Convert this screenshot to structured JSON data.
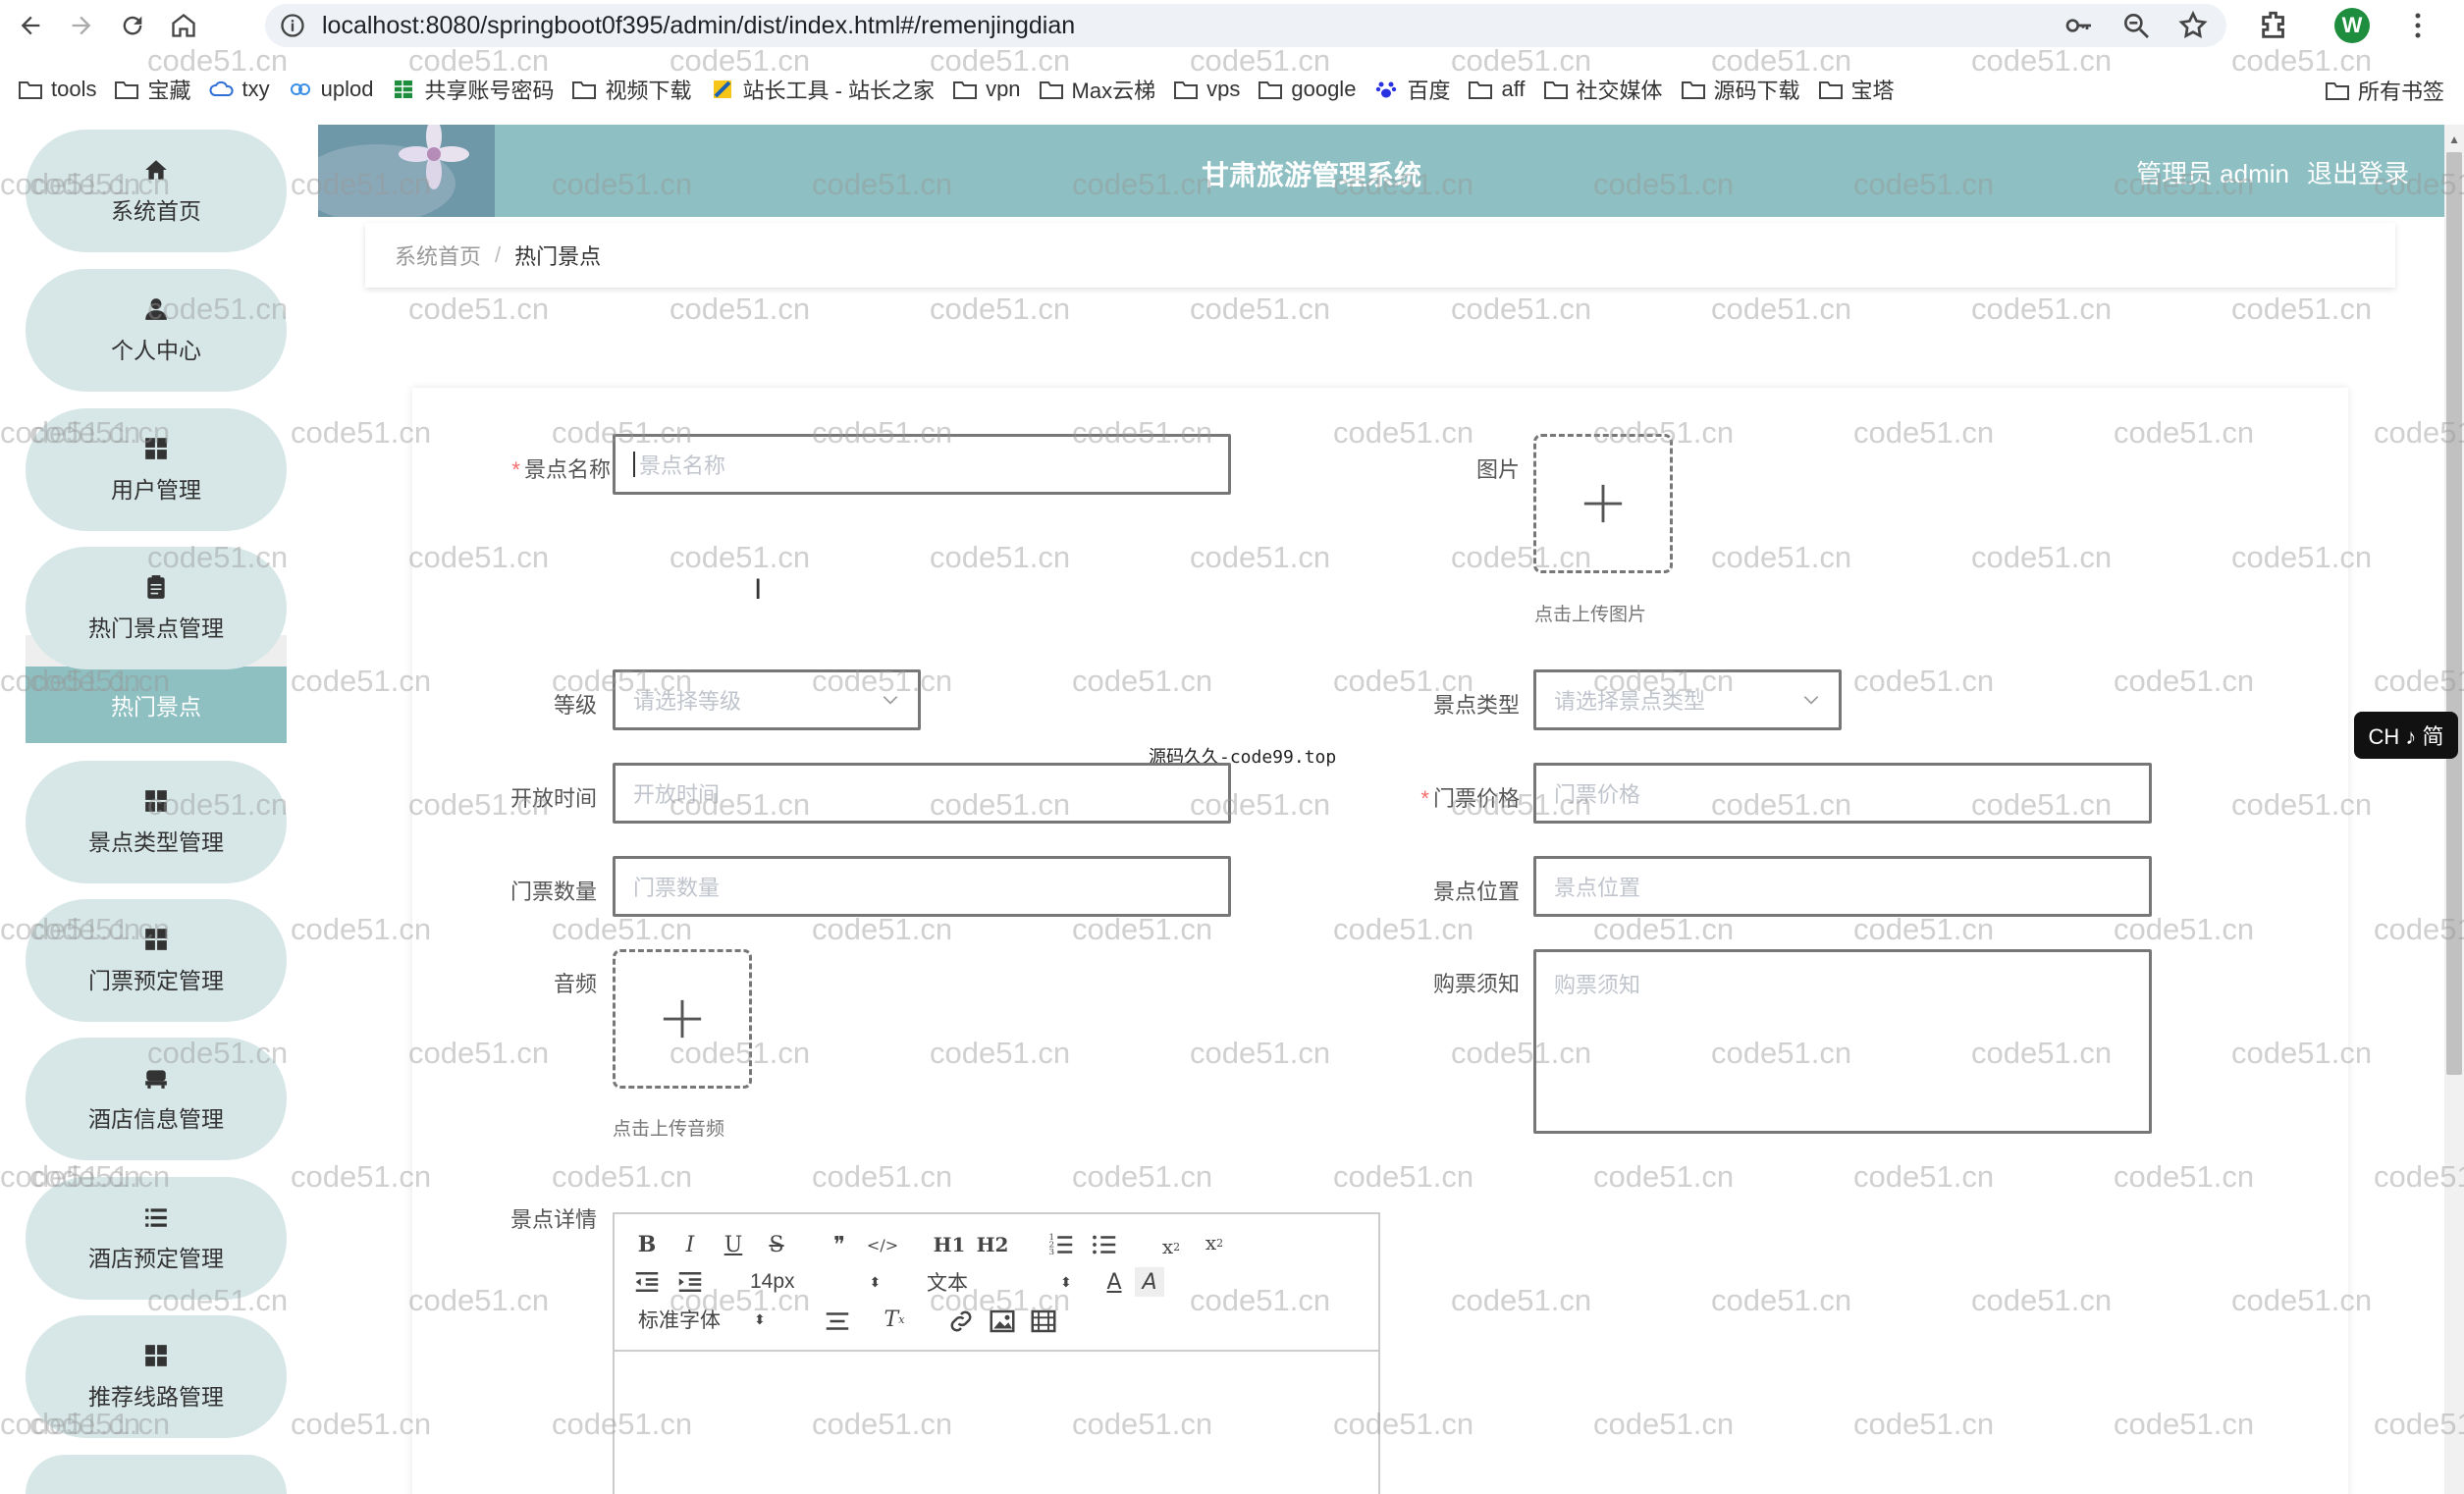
{
  "browser": {
    "url": "localhost:8080/springboot0f395/admin/dist/index.html#/remenjingdian",
    "avatar_letter": "W"
  },
  "bookmarks": {
    "items": [
      "tools",
      "宝藏",
      "txy",
      "uplod",
      "共享账号密码",
      "视频下载",
      "站长工具 - 站长之家",
      "vpn",
      "Max云梯",
      "vps",
      "google",
      "百度",
      "aff",
      "社交媒体",
      "源码下载",
      "宝塔"
    ],
    "all_bookmarks": "所有书签"
  },
  "app": {
    "title": "甘肃旅游管理系统",
    "user_label": "管理员 admin",
    "logout": "退出登录",
    "accent_color": "#8ebfc2"
  },
  "sidebar": {
    "items": [
      {
        "label": "系统首页",
        "icon": "home-icon"
      },
      {
        "label": "个人中心",
        "icon": "user-icon"
      },
      {
        "label": "用户管理",
        "icon": "grid-icon"
      },
      {
        "label": "热门景点管理",
        "icon": "clipboard-icon"
      },
      {
        "label": "景点类型管理",
        "icon": "grid-icon"
      },
      {
        "label": "门票预定管理",
        "icon": "grid-icon"
      },
      {
        "label": "酒店信息管理",
        "icon": "bed-icon"
      },
      {
        "label": "酒店预定管理",
        "icon": "list-icon"
      },
      {
        "label": "推荐线路管理",
        "icon": "grid-icon"
      }
    ],
    "active_submenu": "热门景点"
  },
  "breadcrumb": {
    "home": "系统首页",
    "current": "热门景点"
  },
  "form": {
    "name_label": "景点名称",
    "name_placeholder": "景点名称",
    "image_label": "图片",
    "image_hint": "点击上传图片",
    "level_label": "等级",
    "level_placeholder": "请选择等级",
    "type_label": "景点类型",
    "type_placeholder": "请选择景点类型",
    "open_time_label": "开放时间",
    "open_time_placeholder": "开放时间",
    "price_label": "门票价格",
    "price_placeholder": "门票价格",
    "ticket_count_label": "门票数量",
    "ticket_count_placeholder": "门票数量",
    "location_label": "景点位置",
    "location_placeholder": "景点位置",
    "audio_label": "音频",
    "audio_hint": "点击上传音频",
    "notice_label": "购票须知",
    "notice_placeholder": "购票须知",
    "detail_label": "景点详情"
  },
  "editor": {
    "font_size": "14px",
    "paragraph": "文本",
    "font_family": "标准字体",
    "buttons": [
      "B",
      "I",
      "U",
      "S",
      "❞",
      "</>",
      "H1",
      "H2",
      "ol",
      "ul",
      "x2",
      "x2"
    ]
  },
  "watermark_text": "code51.cn",
  "center_mark": "源码久久-code99.top",
  "ime": "CH ♪ 简"
}
